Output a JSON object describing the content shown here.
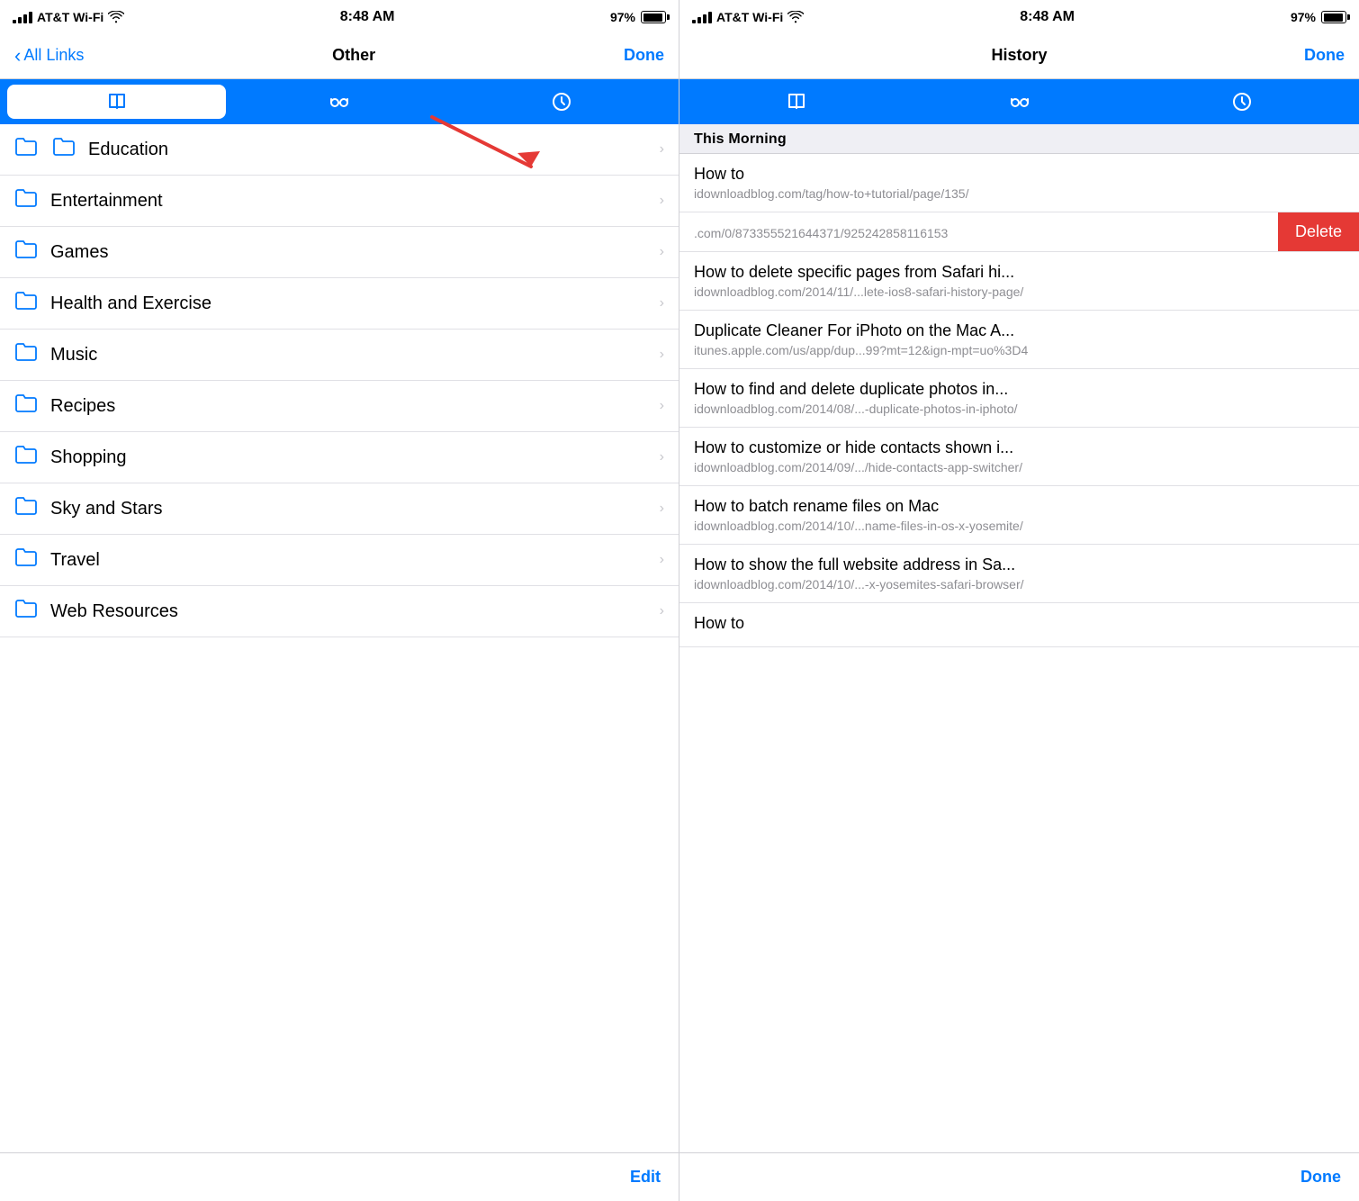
{
  "left_panel": {
    "status": {
      "carrier": "AT&T Wi-Fi",
      "time": "8:48 AM",
      "battery_pct": "97%"
    },
    "nav": {
      "back_label": "All Links",
      "title": "Other",
      "action_label": "Done"
    },
    "tabs": [
      {
        "id": "bookmarks",
        "active": true
      },
      {
        "id": "reading",
        "active": false
      },
      {
        "id": "history",
        "active": false
      }
    ],
    "items": [
      {
        "label": "Education"
      },
      {
        "label": "Entertainment"
      },
      {
        "label": "Games"
      },
      {
        "label": "Health and Exercise"
      },
      {
        "label": "Music"
      },
      {
        "label": "Recipes"
      },
      {
        "label": "Shopping"
      },
      {
        "label": "Sky and Stars"
      },
      {
        "label": "Travel"
      },
      {
        "label": "Web Resources"
      }
    ],
    "bottom_action": "Edit"
  },
  "right_panel": {
    "status": {
      "carrier": "AT&T Wi-Fi",
      "time": "8:48 AM",
      "battery_pct": "97%"
    },
    "nav": {
      "title": "History",
      "action_label": "Done"
    },
    "tabs": [
      {
        "id": "bookmarks",
        "active": false
      },
      {
        "id": "reading",
        "active": false
      },
      {
        "id": "history",
        "active": false
      }
    ],
    "section_header": "This Morning",
    "history_items": [
      {
        "title": "How to",
        "url": "idownloadblog.com/tag/how-to+tutorial/page/135/",
        "swiped": false
      },
      {
        "title": "",
        "url": ".com/0/873355521644371/925242858116153",
        "swiped": true,
        "delete_label": "Delete"
      },
      {
        "title": "How to delete specific pages from Safari hi...",
        "url": "idownloadblog.com/2014/11/...lete-ios8-safari-history-page/",
        "swiped": false
      },
      {
        "title": "Duplicate Cleaner For iPhoto on the Mac A...",
        "url": "itunes.apple.com/us/app/dup...99?mt=12&ign-mpt=uo%3D4",
        "swiped": false
      },
      {
        "title": "How to find and delete duplicate photos in...",
        "url": "idownloadblog.com/2014/08/...-duplicate-photos-in-iphoto/",
        "swiped": false
      },
      {
        "title": "How to customize or hide contacts shown i...",
        "url": "idownloadblog.com/2014/09/.../hide-contacts-app-switcher/",
        "swiped": false
      },
      {
        "title": "How to batch rename files on Mac",
        "url": "idownloadblog.com/2014/10/...name-files-in-os-x-yosemite/",
        "swiped": false
      },
      {
        "title": "How to show the full website address in Sa...",
        "url": "idownloadblog.com/2014/10/...-x-yosemites-safari-browser/",
        "swiped": false
      },
      {
        "title": "How to",
        "url": "",
        "swiped": false
      }
    ],
    "bottom_action": "Done"
  }
}
